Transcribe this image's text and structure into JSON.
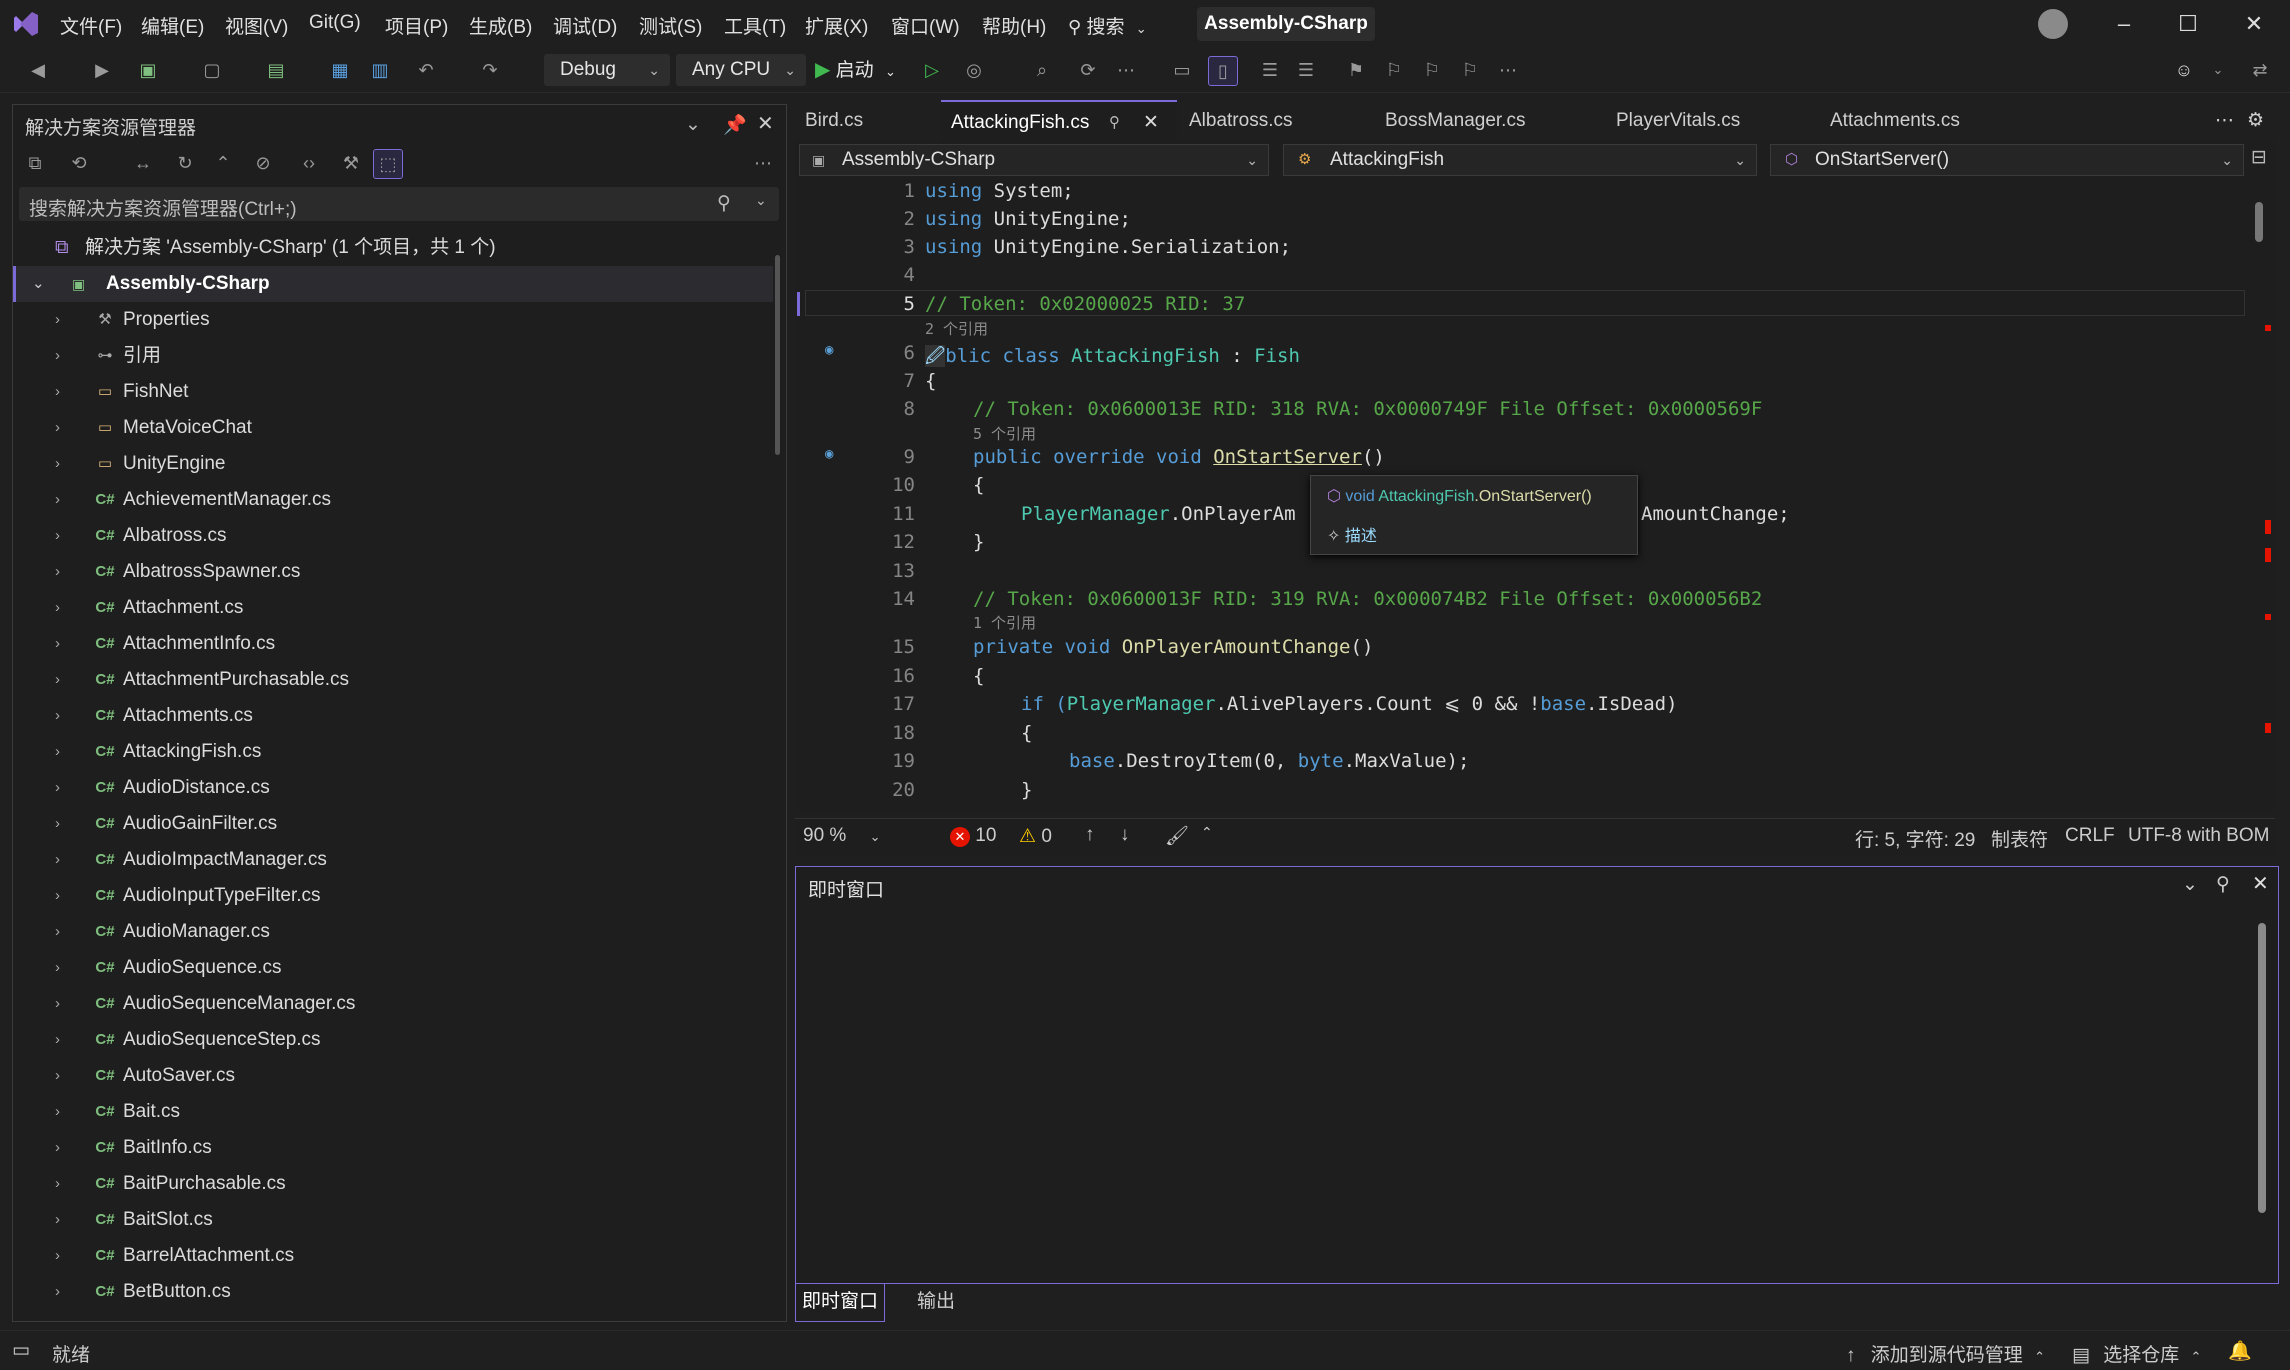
{
  "menu": [
    "文件(F)",
    "编辑(E)",
    "视图(V)",
    "Git(G)",
    "项目(P)",
    "生成(B)",
    "调试(D)",
    "测试(S)",
    "工具(T)",
    "扩展(X)",
    "窗口(W)",
    "帮助(H)"
  ],
  "search_label": "搜索",
  "project_title": "Assembly-CSharp",
  "toolbar": {
    "config": "Debug",
    "platform": "Any CPU",
    "start_label": "启动"
  },
  "solution_explorer": {
    "title": "解决方案资源管理器",
    "search_placeholder": "搜索解决方案资源管理器(Ctrl+;)",
    "solution_label": "解决方案 'Assembly-CSharp' (1 个项目，共 1 个)",
    "project_label": "Assembly-CSharp",
    "items": [
      {
        "label": "Properties",
        "icon": "wrench-icon"
      },
      {
        "label": "引用",
        "icon": "references-icon"
      },
      {
        "label": "FishNet",
        "icon": "folder-icon"
      },
      {
        "label": "MetaVoiceChat",
        "icon": "folder-icon"
      },
      {
        "label": "UnityEngine",
        "icon": "folder-icon"
      },
      {
        "label": "AchievementManager.cs",
        "icon": "csharp-file-icon"
      },
      {
        "label": "Albatross.cs",
        "icon": "csharp-file-icon"
      },
      {
        "label": "AlbatrossSpawner.cs",
        "icon": "csharp-file-icon"
      },
      {
        "label": "Attachment.cs",
        "icon": "csharp-file-icon"
      },
      {
        "label": "AttachmentInfo.cs",
        "icon": "csharp-file-icon"
      },
      {
        "label": "AttachmentPurchasable.cs",
        "icon": "csharp-file-icon"
      },
      {
        "label": "Attachments.cs",
        "icon": "csharp-file-icon"
      },
      {
        "label": "AttackingFish.cs",
        "icon": "csharp-file-icon"
      },
      {
        "label": "AudioDistance.cs",
        "icon": "csharp-file-icon"
      },
      {
        "label": "AudioGainFilter.cs",
        "icon": "csharp-file-icon"
      },
      {
        "label": "AudioImpactManager.cs",
        "icon": "csharp-file-icon"
      },
      {
        "label": "AudioInputTypeFilter.cs",
        "icon": "csharp-file-icon"
      },
      {
        "label": "AudioManager.cs",
        "icon": "csharp-file-icon"
      },
      {
        "label": "AudioSequence.cs",
        "icon": "csharp-file-icon"
      },
      {
        "label": "AudioSequenceManager.cs",
        "icon": "csharp-file-icon"
      },
      {
        "label": "AudioSequenceStep.cs",
        "icon": "csharp-file-icon"
      },
      {
        "label": "AutoSaver.cs",
        "icon": "csharp-file-icon"
      },
      {
        "label": "Bait.cs",
        "icon": "csharp-file-icon"
      },
      {
        "label": "BaitInfo.cs",
        "icon": "csharp-file-icon"
      },
      {
        "label": "BaitPurchasable.cs",
        "icon": "csharp-file-icon"
      },
      {
        "label": "BaitSlot.cs",
        "icon": "csharp-file-icon"
      },
      {
        "label": "BarrelAttachment.cs",
        "icon": "csharp-file-icon"
      },
      {
        "label": "BetButton.cs",
        "icon": "csharp-file-icon"
      }
    ]
  },
  "editor_tabs": [
    "Bird.cs",
    "AttackingFish.cs",
    "Albatross.cs",
    "BossManager.cs",
    "PlayerVitals.cs",
    "Attachments.cs"
  ],
  "nav": {
    "project": "Assembly-CSharp",
    "class": "AttackingFish",
    "member": "OnStartServer()"
  },
  "code": {
    "l1": "using System;",
    "l2": "using UnityEngine;",
    "l3": "using UnityEngine.Serialization;",
    "l5": "// Token: 0x02000025 RID: 37",
    "h6": "2 个引用",
    "l6a": "blic class ",
    "l6b": "AttackingFish",
    "l6c": " : ",
    "l6d": "Fish",
    "l7": "{",
    "l8": "// Token: 0x0600013E RID: 318 RVA: 0x0000749F File Offset: 0x0000569F",
    "h9": "5 个引用",
    "l9a": "public override void ",
    "l9b": "OnStartServer",
    "l9c": "()",
    "l10": "{",
    "l11a": "PlayerManager",
    "l11b": ".OnPlayerAm",
    "l11c": "AmountChange;",
    "l12": "}",
    "l14": "// Token: 0x0600013F RID: 319 RVA: 0x000074B2 File Offset: 0x000056B2",
    "h15": "1 个引用",
    "l15a": "private void ",
    "l15b": "OnPlayerAmountChange",
    "l15c": "()",
    "l16": "{",
    "l17a": "if (",
    "l17b": "PlayerManager",
    "l17c": ".AlivePlayers.Count ⩽ 0 && !",
    "l17d": "base",
    "l17e": ".IsDead)",
    "l18": "{",
    "l19a": "base",
    "l19b": ".DestroyItem(0, ",
    "l19c": "byte",
    "l19d": ".MaxValue);",
    "l20": "}"
  },
  "line_numbers": [
    "1",
    "2",
    "3",
    "4",
    "5",
    "6",
    "7",
    "8",
    "9",
    "10",
    "11",
    "12",
    "13",
    "14",
    "15",
    "16",
    "17",
    "18",
    "19",
    "20"
  ],
  "tooltip": {
    "signature_prefix": "void ",
    "signature_class": "AttackingFish",
    "signature_member": ".OnStartServer()",
    "describe": "描述"
  },
  "editor_status": {
    "zoom": "90 %",
    "errors": "10",
    "warnings": "0",
    "position": "行: 5, 字符: 29",
    "indent": "制表符",
    "eol": "CRLF",
    "encoding": "UTF-8 with BOM"
  },
  "immediate": {
    "title": "即时窗口",
    "tabs": [
      "即时窗口",
      "输出"
    ]
  },
  "statusbar": {
    "ready": "就绪",
    "add_source_control": "添加到源代码管理",
    "select_repo": "选择仓库"
  },
  "colors": {
    "accent": "#7a6bd8",
    "keyword": "#569cd6",
    "type": "#4ec9b0",
    "comment": "#57a64a",
    "method": "#dcdcaa",
    "error": "#e51400",
    "warning": "#ffcc00"
  }
}
